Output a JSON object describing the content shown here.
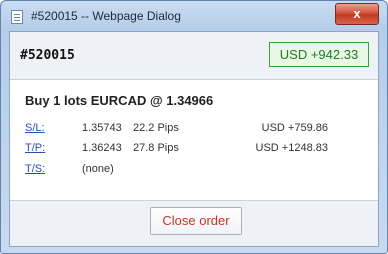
{
  "window": {
    "title": "#520015 -- Webpage Dialog",
    "close_glyph": "x"
  },
  "header": {
    "order_id": "#520015",
    "profit": "USD +942.33"
  },
  "trade": {
    "title": "Buy 1 lots EURCAD @ 1.34966",
    "rows": [
      {
        "label": "S/L:",
        "price": "1.35743",
        "pips": "22.2 Pips",
        "amount": "USD +759.86"
      },
      {
        "label": "T/P:",
        "price": "1.36243",
        "pips": "27.8 Pips",
        "amount": "USD +1248.83"
      },
      {
        "label": "T/S:",
        "price": "(none)",
        "pips": "",
        "amount": ""
      }
    ]
  },
  "footer": {
    "close_order_label": "Close order"
  },
  "colors": {
    "profit_green": "#1e7b26",
    "link_blue": "#2b4fb0",
    "close_red": "#c9332a"
  }
}
